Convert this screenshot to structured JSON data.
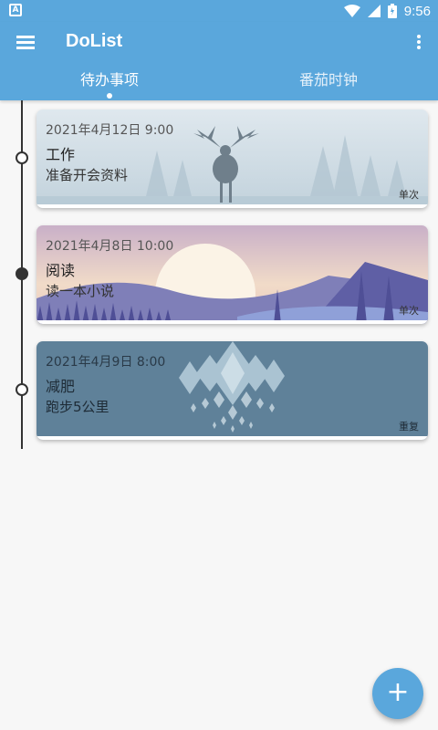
{
  "status_bar": {
    "time": "9:56",
    "notification_icon": "a-box-icon",
    "icons": [
      "wifi-icon",
      "signal-icon",
      "battery-icon"
    ]
  },
  "app_bar": {
    "title": "DoList",
    "menu_icon": "menu-icon",
    "more_icon": "more-vert-icon",
    "color": "#5aa7dc"
  },
  "tabs": [
    {
      "label": "待办事项",
      "active": true
    },
    {
      "label": "番茄时钟",
      "active": false
    }
  ],
  "tasks": [
    {
      "date": "2021年4月12日 9:00",
      "title": "工作",
      "desc": "准备开会资料",
      "type": "单次",
      "node": "hollow",
      "background": "deer-forest-illustration"
    },
    {
      "date": "2021年4月8日 10:00",
      "title": "阅读",
      "desc": "读一本小说",
      "type": "单次",
      "node": "filled",
      "background": "sunset-lake-illustration"
    },
    {
      "date": "2021年4月9日 8:00",
      "title": "减肥",
      "desc": "跑步5公里",
      "type": "重复",
      "node": "hollow",
      "background": "crystal-pattern-illustration"
    }
  ],
  "fab": {
    "label": "+",
    "icon": "add-icon"
  }
}
